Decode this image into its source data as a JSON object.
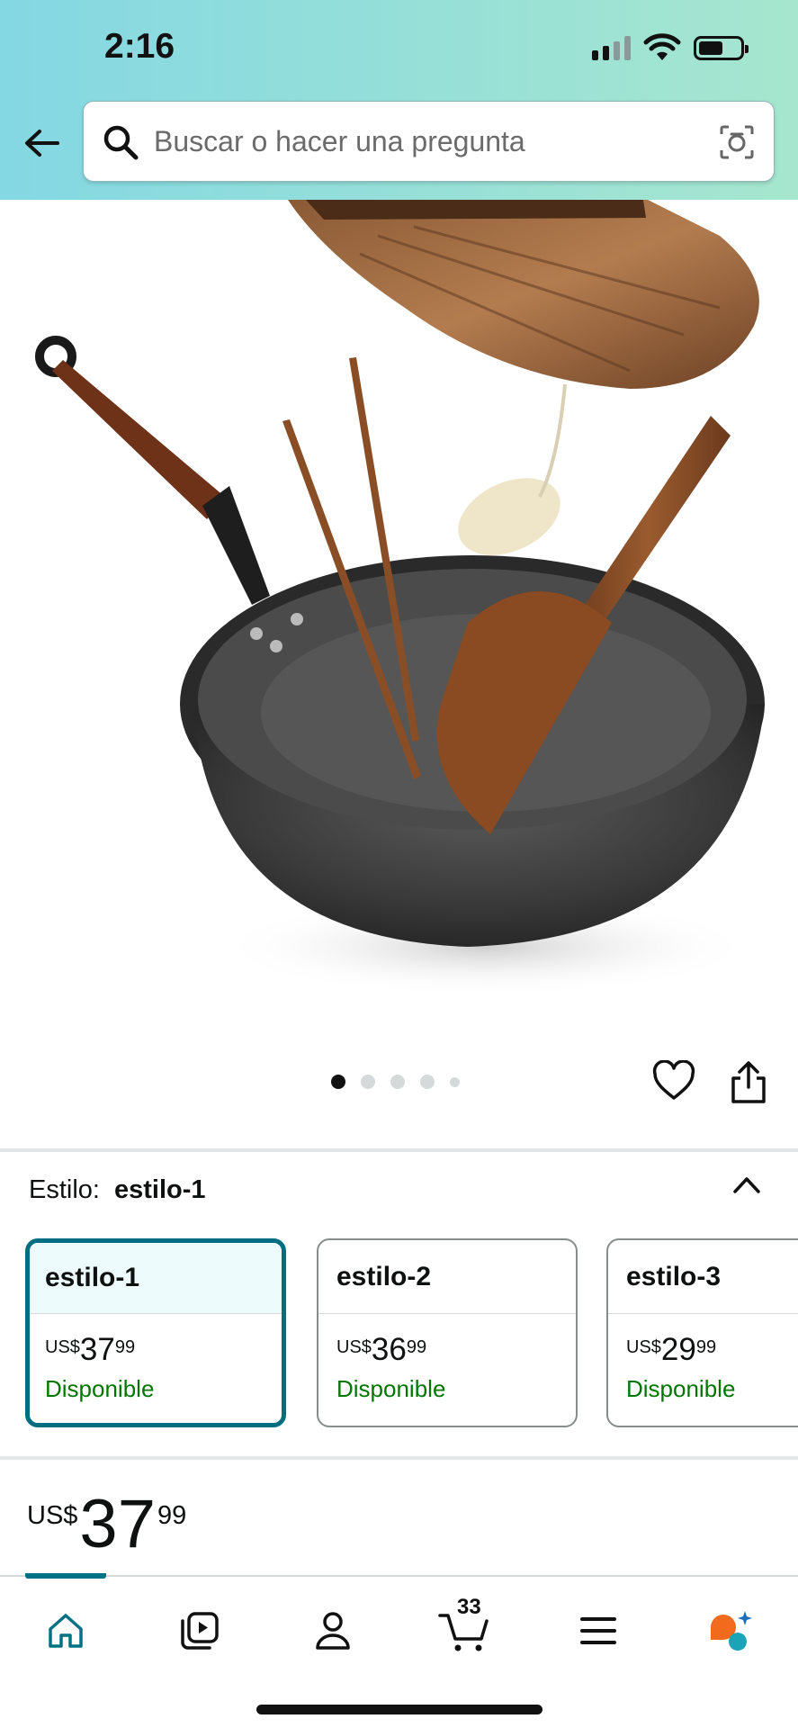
{
  "status_bar": {
    "time": "2:16"
  },
  "search": {
    "placeholder": "Buscar o hacer una pregunta"
  },
  "gallery": {
    "image_count": 5,
    "active_index": 0
  },
  "style_selector": {
    "label": "Estilo:",
    "selected_value": "estilo-1",
    "options": [
      {
        "name": "estilo-1",
        "currency": "US$",
        "whole": "37",
        "fraction": "99",
        "availability": "Disponible",
        "selected": true
      },
      {
        "name": "estilo-2",
        "currency": "US$",
        "whole": "36",
        "fraction": "99",
        "availability": "Disponible",
        "selected": false
      },
      {
        "name": "estilo-3",
        "currency": "US$",
        "whole": "29",
        "fraction": "99",
        "availability": "Disponible",
        "selected": false
      }
    ]
  },
  "price": {
    "currency": "US$",
    "whole": "37",
    "fraction": "99"
  },
  "bottom_nav": {
    "items": [
      "home-icon",
      "video-icon",
      "account-icon",
      "cart-icon",
      "menu-icon",
      "rufus-icon"
    ],
    "active": "home-icon",
    "cart_count": "33"
  },
  "colors": {
    "accent": "#007185",
    "available": "#007600",
    "selected_border": "#006e80"
  }
}
